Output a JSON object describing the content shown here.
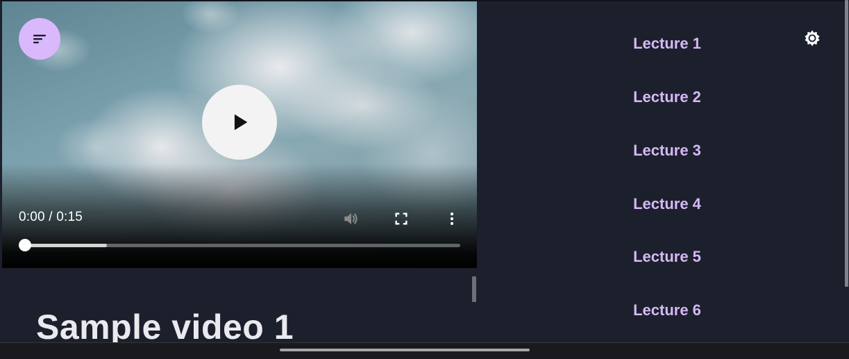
{
  "player": {
    "time_display": "0:00 / 0:15",
    "progress_fraction": 0.0,
    "buffered_fraction": 0.19,
    "icons": {
      "menu": "menu-icon",
      "play": "play-icon",
      "mute": "volume-icon",
      "fullscreen": "fullscreen-icon",
      "more": "more-vert-icon"
    }
  },
  "content": {
    "video_title": "Sample video 1"
  },
  "sidebar": {
    "theme_icon": "brightness-icon",
    "lectures": [
      {
        "label": "Lecture 1"
      },
      {
        "label": "Lecture 2"
      },
      {
        "label": "Lecture 3"
      },
      {
        "label": "Lecture 4"
      },
      {
        "label": "Lecture 5"
      },
      {
        "label": "Lecture 6"
      }
    ]
  },
  "colors": {
    "background": "#1c202c",
    "accent": "#d6b8f7",
    "fab": "#d9b8fb"
  }
}
